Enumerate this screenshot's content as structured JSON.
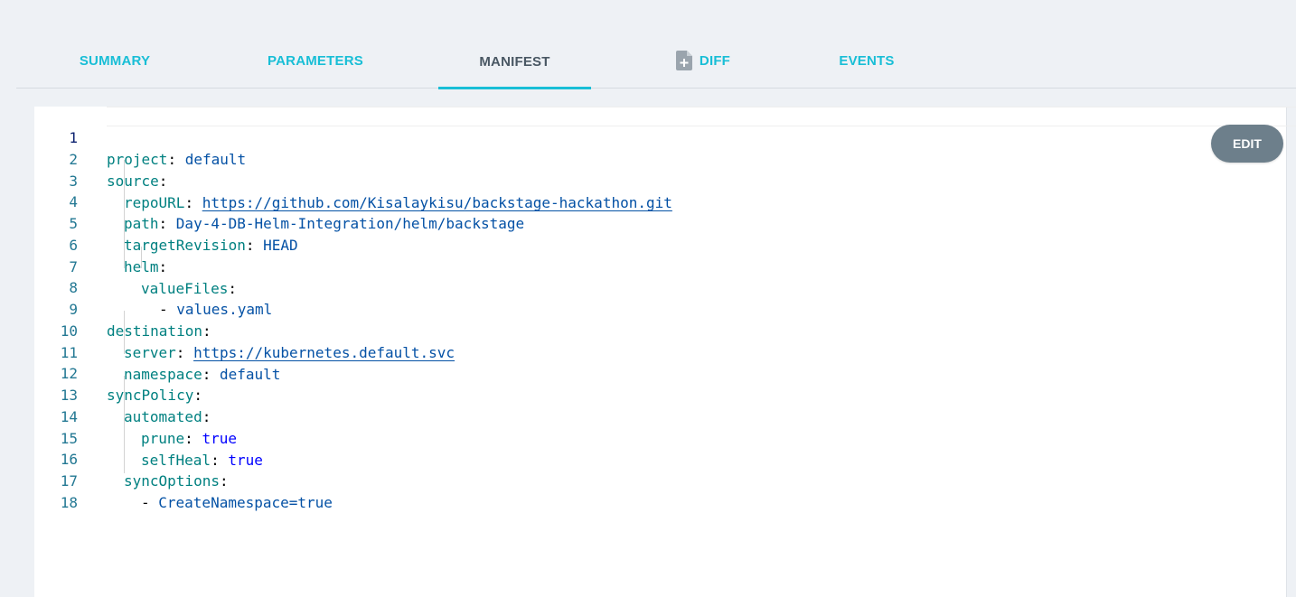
{
  "tabs": [
    {
      "label": "SUMMARY",
      "active": false
    },
    {
      "label": "PARAMETERS",
      "active": false
    },
    {
      "label": "MANIFEST",
      "active": true
    },
    {
      "label": "DIFF",
      "active": false,
      "icon": "file-plus-icon"
    },
    {
      "label": "EVENTS",
      "active": false
    }
  ],
  "edit_button": {
    "label": "EDIT"
  },
  "editor": {
    "line_numbers": [
      "1",
      "2",
      "3",
      "4",
      "5",
      "6",
      "7",
      "8",
      "9",
      "10",
      "11",
      "12",
      "13",
      "14",
      "15",
      "16",
      "17",
      "18"
    ],
    "lines": [
      {
        "key": "project",
        "sep": ": ",
        "value": "default"
      },
      {
        "key": "source",
        "sep": ":"
      },
      {
        "key": "repoURL",
        "sep": ": ",
        "link": "https://github.com/Kisalaykisu/backstage-hackathon.git"
      },
      {
        "key": "path",
        "sep": ": ",
        "value": "Day-4-DB-Helm-Integration/helm/backstage"
      },
      {
        "key": "targetRevision",
        "sep": ": ",
        "value": "HEAD"
      },
      {
        "key": "helm",
        "sep": ":"
      },
      {
        "key": "valueFiles",
        "sep": ":"
      },
      {
        "dash": "- ",
        "value": "values.yaml"
      },
      {
        "key": "destination",
        "sep": ":"
      },
      {
        "key": "server",
        "sep": ": ",
        "link": "https://kubernetes.default.svc"
      },
      {
        "key": "namespace",
        "sep": ": ",
        "value": "default"
      },
      {
        "key": "syncPolicy",
        "sep": ":"
      },
      {
        "key": "automated",
        "sep": ":"
      },
      {
        "key": "prune",
        "sep": ": ",
        "bool": "true"
      },
      {
        "key": "selfHeal",
        "sep": ": ",
        "bool": "true"
      },
      {
        "key": "syncOptions",
        "sep": ":"
      },
      {
        "dash": "- ",
        "value": "CreateNamespace=true"
      },
      {}
    ]
  },
  "colors": {
    "accent": "#18bed6",
    "active_tab_text": "#495763",
    "edit_button_bg": "#6d7f8b",
    "yaml_key": "#008080",
    "yaml_value": "#0451a5",
    "yaml_bool": "#0000ff",
    "line_number": "#237893"
  }
}
